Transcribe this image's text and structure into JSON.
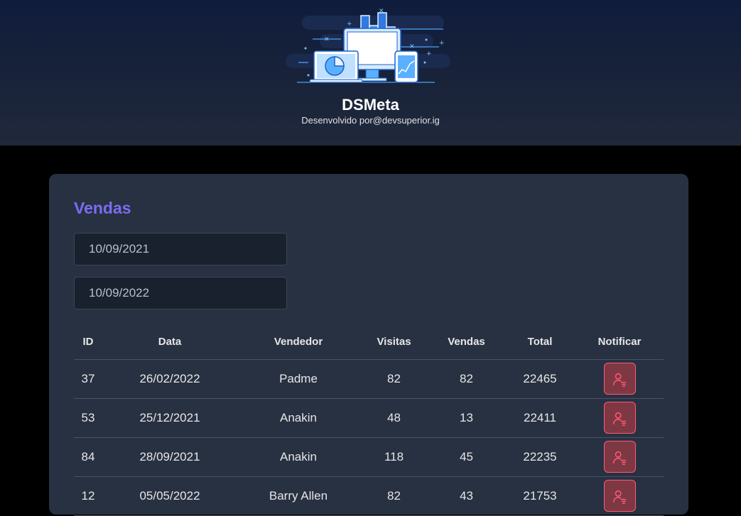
{
  "header": {
    "brand": "DSMeta",
    "dev_prefix": "Desenvolvido por",
    "dev_handle": "@devsuperior.ig"
  },
  "card": {
    "title": "Vendas",
    "min_date": "10/09/2021",
    "max_date": "10/09/2022"
  },
  "table": {
    "headers": {
      "id": "ID",
      "date": "Data",
      "seller": "Vendedor",
      "visits": "Visitas",
      "sales": "Vendas",
      "total": "Total",
      "notify": "Notificar"
    },
    "rows": [
      {
        "id": "37",
        "date": "26/02/2022",
        "seller": "Padme",
        "visits": "82",
        "sales": "82",
        "total": "22465"
      },
      {
        "id": "53",
        "date": "25/12/2021",
        "seller": "Anakin",
        "visits": "48",
        "sales": "13",
        "total": "22411"
      },
      {
        "id": "84",
        "date": "28/09/2021",
        "seller": "Anakin",
        "visits": "118",
        "sales": "45",
        "total": "22235"
      },
      {
        "id": "12",
        "date": "05/05/2022",
        "seller": "Barry Allen",
        "visits": "82",
        "sales": "43",
        "total": "21753"
      }
    ]
  },
  "icons": {
    "logo": "dashboard-illustration-icon",
    "notify": "user-notify-icon"
  },
  "colors": {
    "accent": "#7b6cf2",
    "notify_border": "#ff5a71",
    "notify_bg": "#7e3844",
    "card_bg": "#283142"
  }
}
